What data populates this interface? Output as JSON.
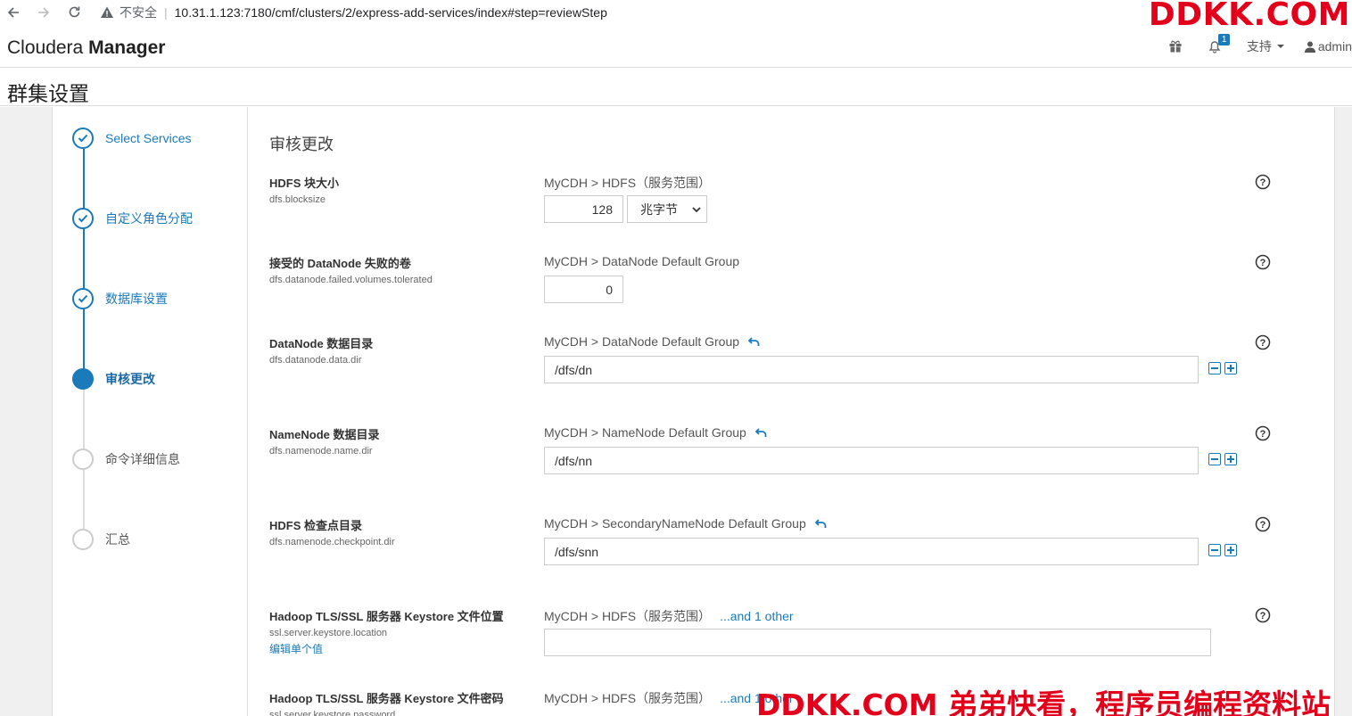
{
  "browser": {
    "insecure_label": "不安全",
    "url": "10.31.1.123:7180/cmf/clusters/2/express-add-services/index#step=reviewStep",
    "watermark": "DDKK.COM"
  },
  "header": {
    "brand_light": "Cloudera",
    "brand_bold": "Manager",
    "notification_count": "1",
    "support_label": "支持",
    "user_label": "admin"
  },
  "page": {
    "title": "群集设置"
  },
  "steps": [
    {
      "label": "Select Services",
      "state": "done"
    },
    {
      "label": "自定义角色分配",
      "state": "done"
    },
    {
      "label": "数据库设置",
      "state": "done"
    },
    {
      "label": "审核更改",
      "state": "active"
    },
    {
      "label": "命令详细信息",
      "state": "todo"
    },
    {
      "label": "汇总",
      "state": "todo"
    }
  ],
  "main": {
    "section_title": "审核更改",
    "rows": [
      {
        "name": "HDFS 块大小",
        "key": "dfs.blocksize",
        "scope": "MyCDH > HDFS（服务范围）",
        "value": "128",
        "unit": "兆字节"
      },
      {
        "name": "接受的 DataNode 失败的卷",
        "key": "dfs.datanode.failed.volumes.tolerated",
        "scope": "MyCDH > DataNode Default Group",
        "value": "0"
      },
      {
        "name": "DataNode 数据目录",
        "key": "dfs.datanode.data.dir",
        "scope": "MyCDH > DataNode Default Group",
        "value": "/dfs/dn"
      },
      {
        "name": "NameNode 数据目录",
        "key": "dfs.namenode.name.dir",
        "scope": "MyCDH > NameNode Default Group",
        "value": "/dfs/nn"
      },
      {
        "name": "HDFS 检查点目录",
        "key": "dfs.namenode.checkpoint.dir",
        "scope": "MyCDH > SecondaryNameNode Default Group",
        "value": "/dfs/snn"
      },
      {
        "name": "Hadoop TLS/SSL 服务器 Keystore 文件位置",
        "key": "ssl.server.keystore.location",
        "edit_link": "编辑单个值",
        "scope": "MyCDH > HDFS（服务范围）",
        "more": "...and 1 other",
        "value": ""
      },
      {
        "name": "Hadoop TLS/SSL 服务器 Keystore 文件密码",
        "key": "ssl.server.keystore.password",
        "scope": "MyCDH > HDFS（服务范围）",
        "more": "...and 1 other"
      }
    ]
  },
  "watermark_bottom": "DDKK.COM 弟弟快看，程序员编程资料站",
  "colors": {
    "accent": "#1b7ab9",
    "watermark": "#e3001b"
  }
}
